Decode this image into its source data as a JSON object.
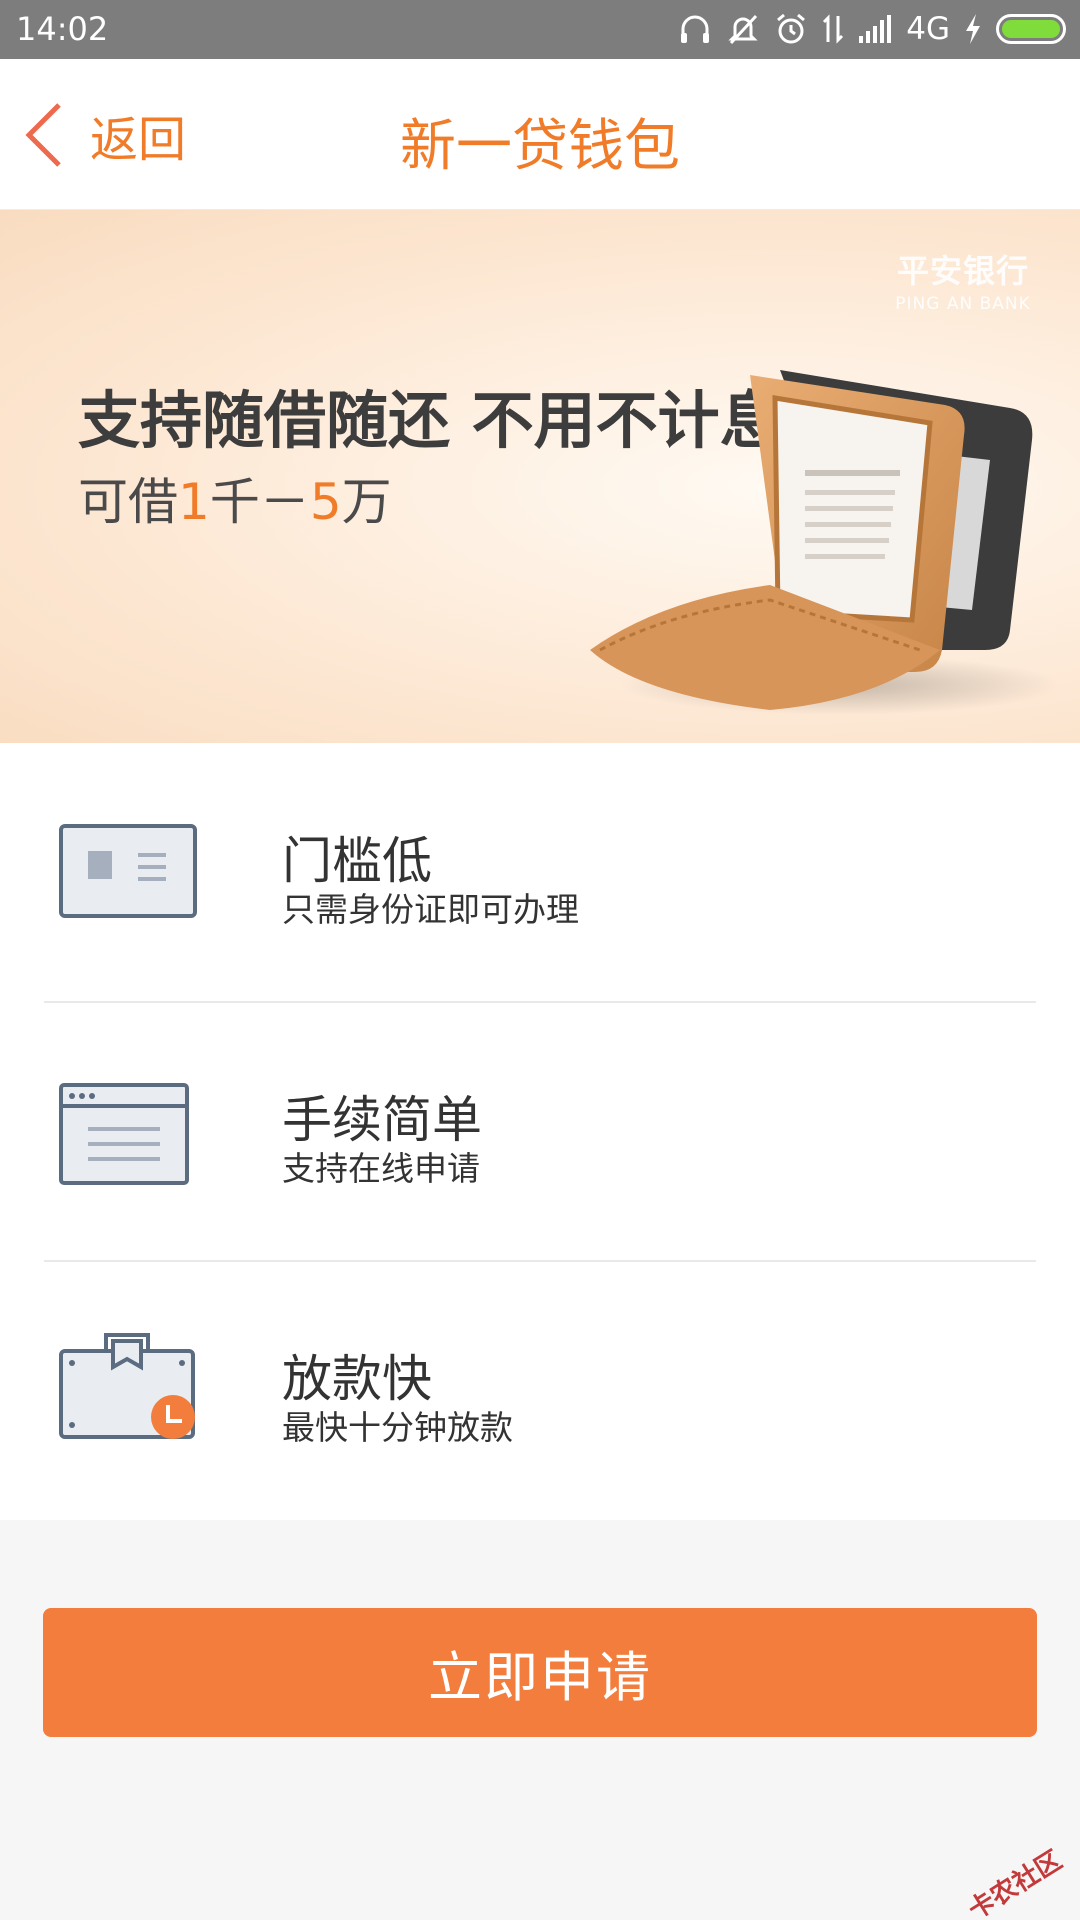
{
  "status_bar": {
    "time": "14:02",
    "network": "4G",
    "battery_level": 1.0,
    "icons": [
      "headset-icon",
      "silent-icon",
      "alarm-icon",
      "data-transfer-icon",
      "signal-icon",
      "charging-icon",
      "battery-icon"
    ]
  },
  "nav": {
    "back_label": "返回",
    "title": "新一贷钱包"
  },
  "banner": {
    "brand_cn": "平安银行",
    "brand_en": "PING AN BANK",
    "headline": "支持随借随还 不用不计息",
    "sub_prefix": "可借",
    "sub_amount_min": "1",
    "sub_middle": "千－",
    "sub_amount_max": "5",
    "sub_suffix": "万"
  },
  "features": [
    {
      "icon": "id-card-icon",
      "title": "门槛低",
      "description": "只需身份证即可办理"
    },
    {
      "icon": "browser-window-icon",
      "title": "手续简单",
      "description": "支持在线申请"
    },
    {
      "icon": "briefcase-clock-icon",
      "title": "放款快",
      "description": "最快十分钟放款"
    }
  ],
  "apply_button": {
    "label": "立即申请"
  },
  "watermark": "卡农社区",
  "colors": {
    "accent": "#f07c2a",
    "button": "#f37d3c",
    "status_bar": "#7d7d7d",
    "icon_stroke": "#5b6b80",
    "icon_fill": "#e9edf2"
  }
}
